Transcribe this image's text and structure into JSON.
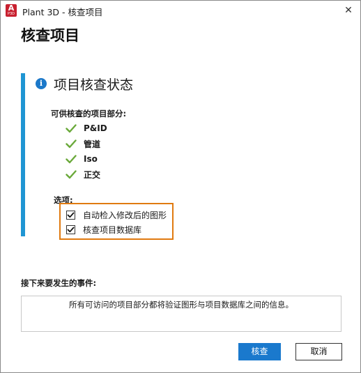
{
  "window": {
    "title": "Plant 3D - 核查项目",
    "app_icon_letter": "A",
    "app_icon_sub": "P3D",
    "close_glyph": "✕"
  },
  "page_title": "核查项目",
  "status": {
    "info_glyph": "i",
    "heading": "项目核查状态",
    "parts_label": "可供核查的项目部分:",
    "parts": [
      "P&ID",
      "管道",
      "Iso",
      "正交"
    ]
  },
  "options": {
    "label": "选项:",
    "items": [
      {
        "label": "自动检入修改后的图形",
        "checked": true
      },
      {
        "label": "核查项目数据库",
        "checked": true
      }
    ]
  },
  "next_events": {
    "label": "接下来要发生的事件:",
    "text": "所有可访问的项目部分都将验证图形与项目数据库之间的信息。"
  },
  "buttons": {
    "primary": "核查",
    "cancel": "取消"
  },
  "colors": {
    "accent_blue": "#1f95d3",
    "check_green": "#6aa93a",
    "highlight_orange": "#e07a10",
    "primary_button": "#1a79cd"
  }
}
